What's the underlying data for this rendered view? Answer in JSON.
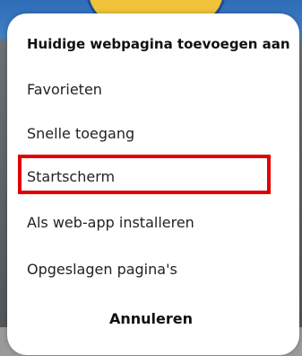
{
  "sheet": {
    "title": "Huidige webpagina toevoegen aan",
    "items": [
      {
        "label": "Favorieten"
      },
      {
        "label": "Snelle toegang"
      },
      {
        "label": "Startscherm",
        "highlighted": true
      },
      {
        "label": "Als web-app installeren"
      },
      {
        "label": "Opgeslagen pagina's"
      }
    ],
    "cancel_label": "Annuleren"
  },
  "colors": {
    "highlight": "#e00000",
    "sheet_background": "#ffffff",
    "text": "#222222"
  }
}
